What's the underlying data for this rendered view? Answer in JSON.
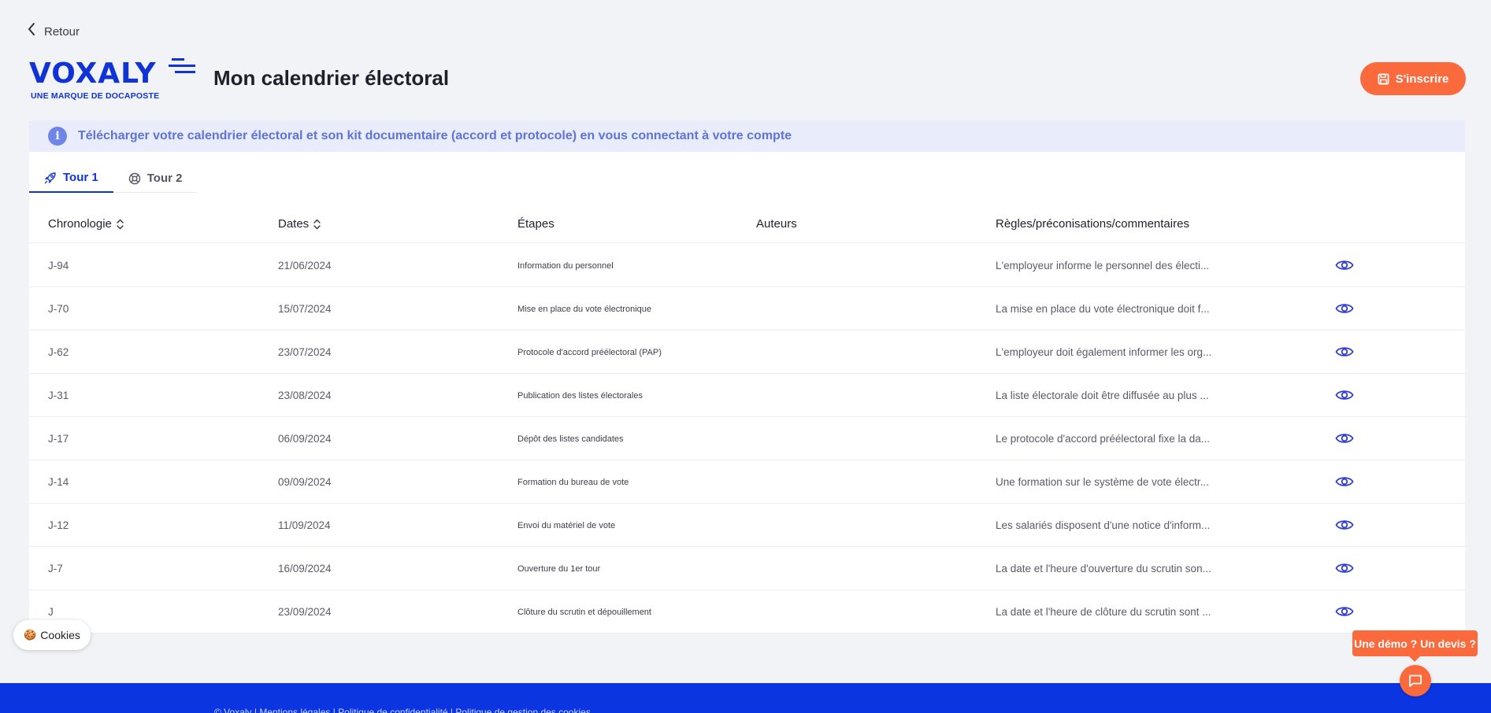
{
  "nav": {
    "back_label": "Retour"
  },
  "brand": {
    "name": "VOXALY",
    "tagline": "UNE MARQUE DE DOCAPOSTE",
    "color": "#1033d8"
  },
  "header": {
    "title": "Mon calendrier électoral",
    "signup_label": "S'inscrire",
    "accent": "#fa6a3c"
  },
  "banner": {
    "text": "Télécharger votre calendrier électoral et son kit documentaire (accord et protocole) en vous connectant à votre compte"
  },
  "tabs": [
    {
      "label": "Tour 1",
      "active": true,
      "icon": "rocket-icon"
    },
    {
      "label": "Tour 2",
      "active": false,
      "icon": "lifebuoy-icon"
    }
  ],
  "table": {
    "columns": [
      "Chronologie",
      "Dates",
      "Étapes",
      "Auteurs",
      "Règles/préconisations/commentaires"
    ],
    "rows": [
      {
        "chrono": "J-94",
        "date": "21/06/2024",
        "step": "Information du personnel",
        "author": "",
        "rule": "L'employeur informe le personnel des électi..."
      },
      {
        "chrono": "J-70",
        "date": "15/07/2024",
        "step": "Mise en place du vote électronique",
        "author": "",
        "rule": "La mise en place du vote électronique doit f..."
      },
      {
        "chrono": "J-62",
        "date": "23/07/2024",
        "step": "Protocole d'accord préélectoral (PAP)",
        "author": "",
        "rule": "L'employeur doit également informer les org..."
      },
      {
        "chrono": "J-31",
        "date": "23/08/2024",
        "step": "Publication des listes électorales",
        "author": "",
        "rule": "La liste électorale doit être diffusée au plus ..."
      },
      {
        "chrono": "J-17",
        "date": "06/09/2024",
        "step": "Dépôt des listes candidates",
        "author": "",
        "rule": "Le protocole d'accord préélectoral fixe la da..."
      },
      {
        "chrono": "J-14",
        "date": "09/09/2024",
        "step": "Formation du bureau de vote",
        "author": "",
        "rule": "Une formation sur le système de vote électr..."
      },
      {
        "chrono": "J-12",
        "date": "11/09/2024",
        "step": "Envoi du matériel de vote",
        "author": "",
        "rule": "Les salariés disposent d'une notice d'inform..."
      },
      {
        "chrono": "J-7",
        "date": "16/09/2024",
        "step": "Ouverture du 1er tour",
        "author": "",
        "rule": "La date et l'heure d'ouverture du scrutin son..."
      },
      {
        "chrono": "J",
        "date": "23/09/2024",
        "step": "Clôture du scrutin et dépouillement",
        "author": "",
        "rule": "La date et l'heure de clôture du scrutin sont ..."
      }
    ]
  },
  "cookies": {
    "label": "Cookies"
  },
  "demo": {
    "label": "Une démo ? Un devis ?"
  },
  "footer": {
    "links_text": "© Voxaly | Mentions légales | Politique de confidentialité | Politique de gestion des cookies"
  }
}
